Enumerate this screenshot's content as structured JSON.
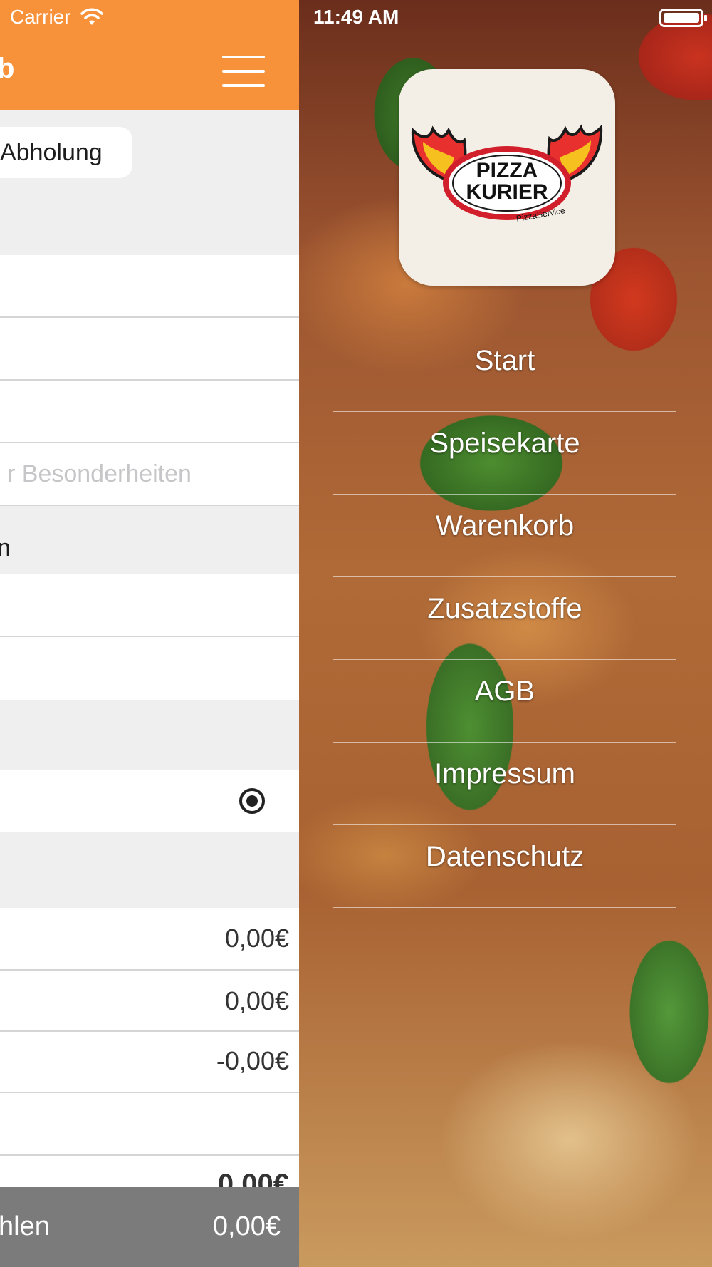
{
  "status_bar": {
    "carrier": "Carrier",
    "time": "11:49 AM"
  },
  "cart": {
    "nav_title_partial": "b",
    "delivery_pill": "Abholung",
    "notes_placeholder": "r Besonderheiten",
    "section_partial": "n",
    "price_rows": [
      "0,00€",
      "0,00€",
      "-0,00€"
    ],
    "total_partial": "0,00€",
    "footer": {
      "label": "hlen",
      "amount": "0,00€"
    }
  },
  "menu": {
    "logo": {
      "line1": "PIZZA",
      "line2": "KURIER",
      "tagline": "PizzaService"
    },
    "items": [
      "Start",
      "Speisekarte",
      "Warenkorb",
      "Zusatzstoffe",
      "AGB",
      "Impressum",
      "Datenschutz"
    ]
  },
  "colors": {
    "brand_orange": "#f7913a",
    "footer_gray": "#7b7b7b",
    "logo_red": "#e8302f",
    "logo_yellow": "#f7d21d"
  }
}
